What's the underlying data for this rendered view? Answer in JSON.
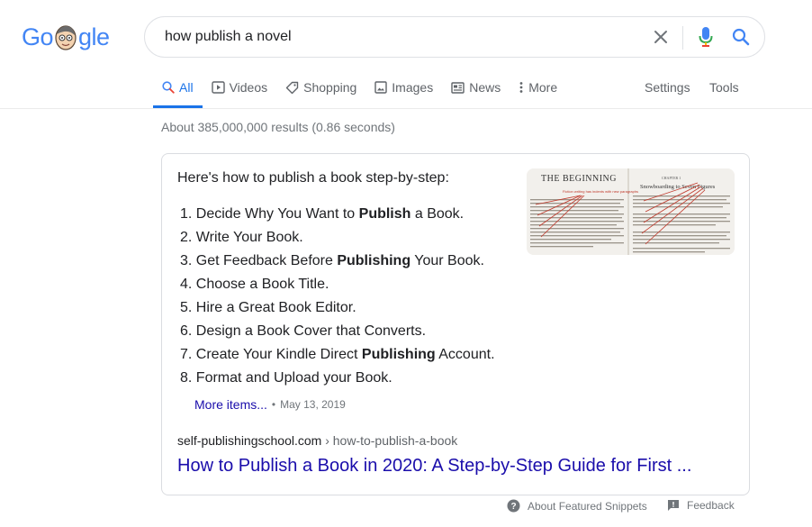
{
  "logo": {
    "letters_before": "Go",
    "letters_after": "gle"
  },
  "search": {
    "query": "how publish a novel"
  },
  "tabs": [
    {
      "label": "All",
      "icon": "search-icon",
      "active": true
    },
    {
      "label": "Videos",
      "icon": "video-icon"
    },
    {
      "label": "Shopping",
      "icon": "tag-icon"
    },
    {
      "label": "Images",
      "icon": "image-icon"
    },
    {
      "label": "News",
      "icon": "news-icon"
    },
    {
      "label": "More",
      "icon": "more-vert-icon"
    }
  ],
  "tools": {
    "settings": "Settings",
    "tools": "Tools"
  },
  "stats": "About 385,000,000 results (0.86 seconds)",
  "snippet": {
    "heading": "Here's how to publish a book step-by-step:",
    "items": [
      {
        "num": "1.",
        "pre": "Decide Why You Want to ",
        "bold": "Publish",
        "post": " a Book."
      },
      {
        "num": "2.",
        "pre": "Write Your Book.",
        "bold": "",
        "post": ""
      },
      {
        "num": "3.",
        "pre": "Get Feedback Before ",
        "bold": "Publishing",
        "post": " Your Book."
      },
      {
        "num": "4.",
        "pre": "Choose a Book Title.",
        "bold": "",
        "post": ""
      },
      {
        "num": "5.",
        "pre": "Hire a Great Book Editor.",
        "bold": "",
        "post": ""
      },
      {
        "num": "6.",
        "pre": "Design a Book Cover that Converts.",
        "bold": "",
        "post": ""
      },
      {
        "num": "7.",
        "pre": "Create Your Kindle Direct ",
        "bold": "Publishing",
        "post": " Account."
      },
      {
        "num": "8.",
        "pre": "Format and Upload your Book.",
        "bold": "",
        "post": ""
      }
    ],
    "more_items": "More items...",
    "date": "May 13, 2019",
    "image": {
      "left_heading": "THE BEGINNING",
      "left_annotation": "Fiction writing has indents with new paragraphs",
      "right_chapter": "CHAPTER 1",
      "right_heading": "Snowboarding to Seven Figures"
    },
    "cite_domain": "self-publishingschool.com",
    "cite_path": " › how-to-publish-a-book",
    "link_title": "How to Publish a Book in 2020: A Step-by-Step Guide for First ..."
  },
  "footer": {
    "about": "About Featured Snippets",
    "feedback": "Feedback"
  },
  "colors": {
    "link": "#1a0dab",
    "accent": "#1a73e8",
    "muted": "#70757a"
  }
}
